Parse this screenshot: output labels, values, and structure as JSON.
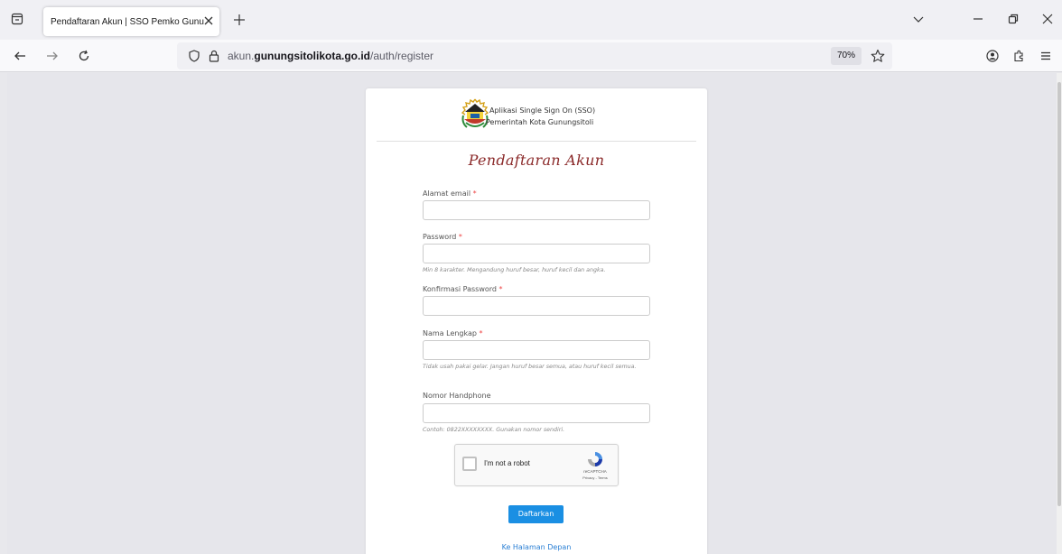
{
  "browser": {
    "tab_title": "Pendaftaran Akun | SSO Pemko Gunungsitoli",
    "url_domain_prefix": "akun.",
    "url_domain": "gunungsitolikota.go.id",
    "url_path": "/auth/register",
    "zoom": "70%",
    "icons": [
      "tab-list-icon",
      "close-icon",
      "plus-icon",
      "chevron-down-icon",
      "minimize-icon",
      "restore-icon",
      "window-close-icon",
      "back-arrow-icon",
      "forward-arrow-icon",
      "reload-icon",
      "shield-icon",
      "lock-icon",
      "star-icon",
      "account-icon",
      "extensions-icon",
      "menu-icon"
    ]
  },
  "header": {
    "app_name": "Aplikasi Single Sign On (SSO)",
    "org_name": "Pemerintah Kota Gunungsitoli",
    "logo": "city-emblem-logo"
  },
  "form": {
    "heading": "Pendaftaran Akun",
    "email": {
      "label": "Alamat email",
      "required": "*",
      "value": ""
    },
    "password": {
      "label": "Password",
      "required": "*",
      "value": "",
      "help": "Min 8 karakter. Mengandung huruf besar, huruf kecil dan angka."
    },
    "confirm_password": {
      "label": "Konfirmasi Password",
      "required": "*",
      "value": ""
    },
    "full_name": {
      "label": "Nama Lengkap",
      "required": "*",
      "value": "",
      "help": "Tidak usah pakai gelar. Jangan huruf besar semua, atau huruf kecil semua."
    },
    "phone": {
      "label": "Nomor Handphone",
      "value": "",
      "help": "Contoh: 0822XXXXXXXX. Gunakan nomor sendiri."
    },
    "captcha": {
      "label": "I'm not a robot",
      "brand": "reCAPTCHA",
      "terms": "Privacy - Terms"
    },
    "submit_label": "Daftarkan",
    "home_link": "Ke Halaman Depan"
  },
  "colors": {
    "accent": "#1a8fe3",
    "heading": "#8b2a2a",
    "required": "#ee4444",
    "link": "#2a7fd4"
  }
}
